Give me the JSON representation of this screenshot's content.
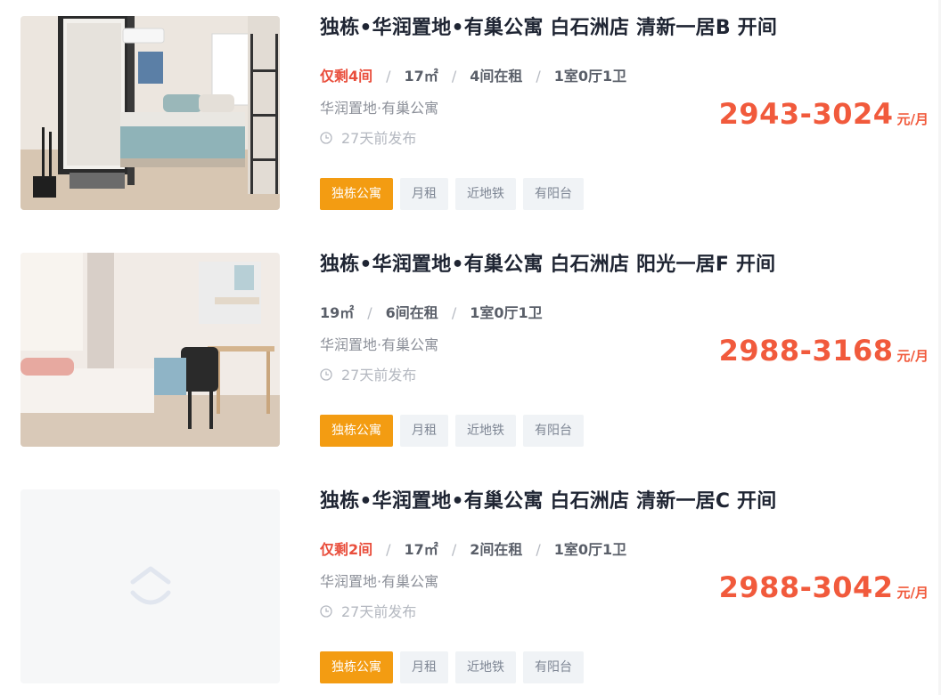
{
  "listings": [
    {
      "title": "独栋•华润置地•有巢公寓 白石洲店 清新一居B 开间",
      "remaining": "仅剩4间",
      "area": "17㎡",
      "in_rent": "4间在租",
      "layout": "1室0厅1卫",
      "brand": "华润置地·有巢公寓",
      "published": "27天前发布",
      "price": "2943-3024",
      "price_unit": "元/月",
      "tags": [
        "独栋公寓",
        "月租",
        "近地铁",
        "有阳台"
      ]
    },
    {
      "title": "独栋•华润置地•有巢公寓 白石洲店 阳光一居F 开间",
      "remaining": "",
      "area": "19㎡",
      "in_rent": "6间在租",
      "layout": "1室0厅1卫",
      "brand": "华润置地·有巢公寓",
      "published": "27天前发布",
      "price": "2988-3168",
      "price_unit": "元/月",
      "tags": [
        "独栋公寓",
        "月租",
        "近地铁",
        "有阳台"
      ]
    },
    {
      "title": "独栋•华润置地•有巢公寓 白石洲店 清新一居C 开间",
      "remaining": "仅剩2间",
      "area": "17㎡",
      "in_rent": "2间在租",
      "layout": "1室0厅1卫",
      "brand": "华润置地·有巢公寓",
      "published": "27天前发布",
      "price": "2988-3042",
      "price_unit": "元/月",
      "tags": [
        "独栋公寓",
        "月租",
        "近地铁",
        "有阳台"
      ]
    }
  ],
  "colors": {
    "price": "#f15a3c",
    "remaining": "#e94e3c",
    "primary_tag": "#f39c12",
    "title": "#1f2533"
  },
  "icons": {
    "published": "clock-icon",
    "placeholder": "house-placeholder-icon"
  }
}
